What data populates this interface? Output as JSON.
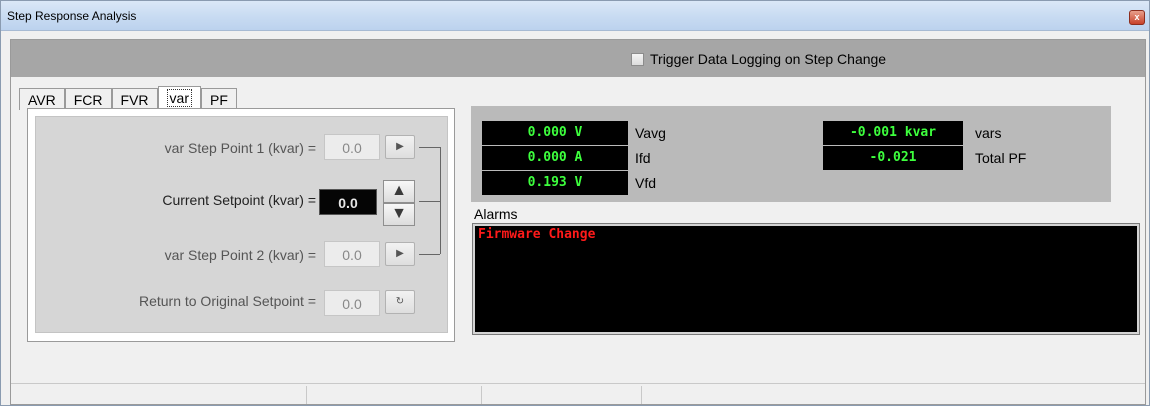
{
  "window": {
    "title": "Step Response Analysis",
    "close_glyph": "x"
  },
  "header": {
    "trigger_label": "Trigger Data Logging on Step Change",
    "trigger_checked": false
  },
  "tabs": [
    {
      "label": "AVR",
      "active": false
    },
    {
      "label": "FCR",
      "active": false
    },
    {
      "label": "FVR",
      "active": false
    },
    {
      "label": "var",
      "active": true
    },
    {
      "label": "PF",
      "active": false
    }
  ],
  "step": {
    "point1_label": "var Step Point 1 (kvar) =",
    "point1_value": "0.0",
    "current_label": "Current Setpoint (kvar) =",
    "current_value": "0.0",
    "point2_label": "var Step Point 2 (kvar) =",
    "point2_value": "0.0",
    "return_label": "Return to Original Setpoint =",
    "return_value": "0.0"
  },
  "metrics": {
    "vavg_value": "0.000 V",
    "vavg_label": "Vavg",
    "ifd_value": "0.000 A",
    "ifd_label": "Ifd",
    "vfd_value": "0.193 V",
    "vfd_label": "Vfd",
    "vars_value": "-0.001 kvar",
    "vars_label": "vars",
    "pf_value": "-0.021",
    "pf_label": "Total PF",
    "value_color": "#3dff3d"
  },
  "alarms": {
    "label": "Alarms",
    "items": [
      "Firmware Change"
    ],
    "item_color": "#ff1a1a"
  },
  "icons": {
    "play": "play-icon",
    "up": "spin-up-icon",
    "down": "spin-down-icon",
    "refresh": "refresh-icon"
  }
}
